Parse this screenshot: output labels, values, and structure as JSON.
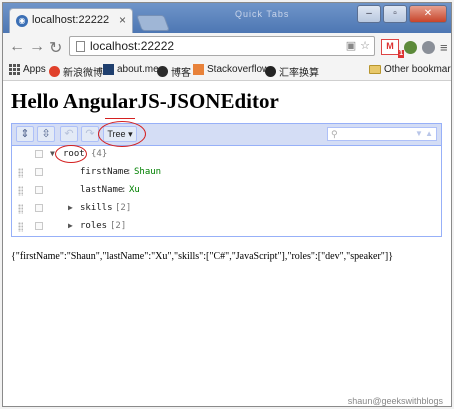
{
  "browser": {
    "tab_title": "localhost:22222",
    "faint_tabs": "Quick Tabs",
    "url": "localhost:22222",
    "bookmarks": [
      {
        "label": "Apps",
        "icon": "apps-icon"
      },
      {
        "label": "新浪微博",
        "icon": "weibo-icon"
      },
      {
        "label": "about.me",
        "icon": "aboutme-icon"
      },
      {
        "label": "博客",
        "icon": "blog-icon"
      },
      {
        "label": "Stackoverflow",
        "icon": "stackoverflow-icon"
      },
      {
        "label": "汇率换算",
        "icon": "exchange-icon"
      }
    ],
    "other_bookmarks": "Other bookmarks",
    "gmail_badge": "1"
  },
  "page": {
    "title": "Hello AngularJS-JSONEditor",
    "output": "{\"firstName\":\"Shaun\",\"lastName\":\"Xu\",\"skills\":[\"C#\",\"JavaScript\"],\"roles\":[\"dev\",\"speaker\"]}"
  },
  "editor": {
    "mode_label": "Tree ▾",
    "root": {
      "field": "root",
      "count": "{4}"
    },
    "rows": [
      {
        "field": "firstName",
        "sep": ":",
        "value": "Shaun"
      },
      {
        "field": "lastName",
        "sep": ":",
        "value": "Xu"
      },
      {
        "field": "skills",
        "count": "[2]"
      },
      {
        "field": "roles",
        "count": "[2]"
      }
    ]
  },
  "watermark": "shaun@geekswithblogs",
  "colors": {
    "editor_border": "#97b0f8",
    "editor_menu": "#d4ddf5",
    "string_value": "#008000",
    "annotation": "#d42020"
  }
}
